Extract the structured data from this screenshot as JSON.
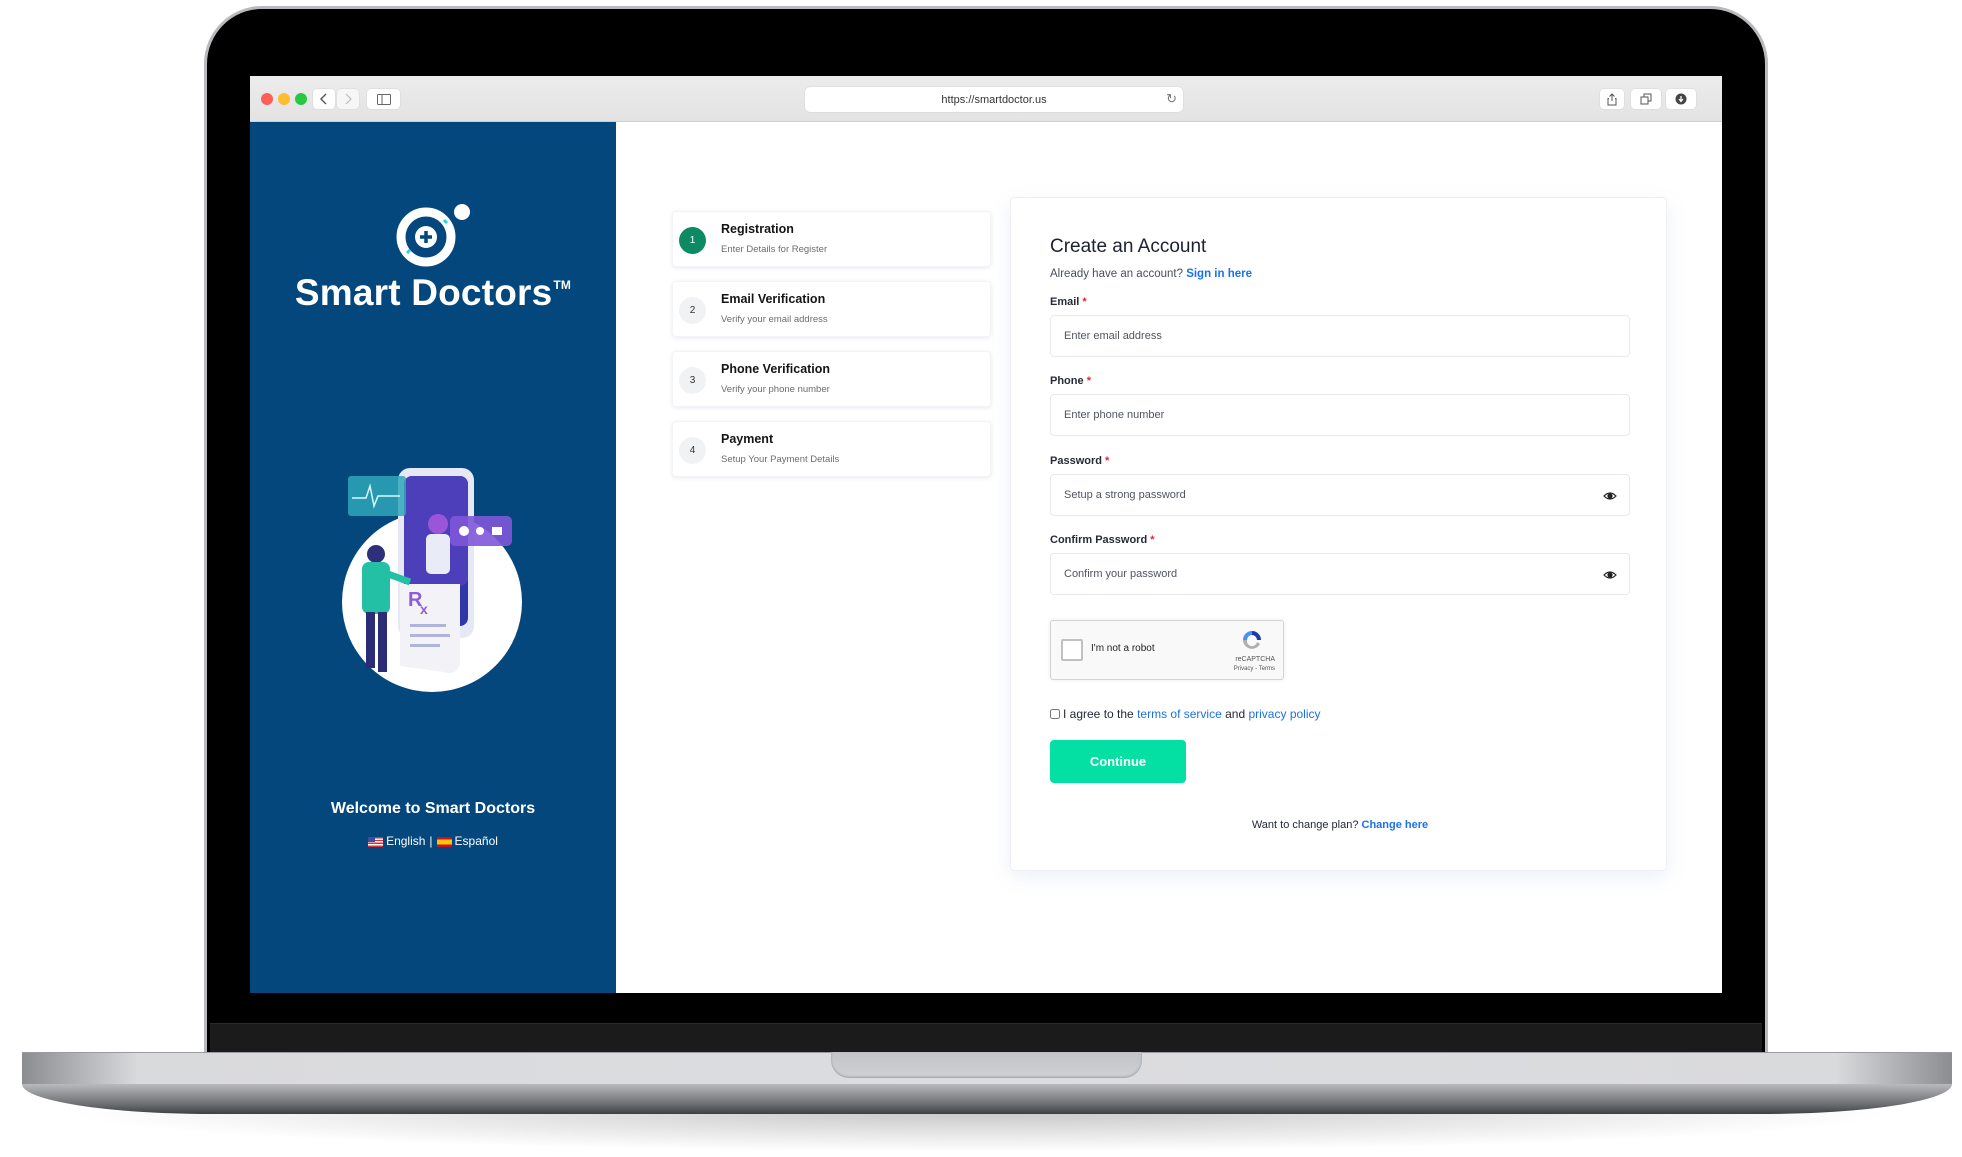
{
  "browser": {
    "url": "https://smartdoctor.us",
    "back_icon": "chevron-left-icon",
    "forward_icon": "chevron-right-icon",
    "sidebar_icon": "sidebar-icon",
    "reload_icon": "reload-icon",
    "share_icon": "share-icon",
    "tabs_icon": "tabs-icon",
    "download_icon": "download-icon"
  },
  "sidebar": {
    "brand": "Smart Doctors",
    "trademark": "TM",
    "welcome": "Welcome to Smart Doctors",
    "languages": [
      {
        "label": "English",
        "flag": "us-flag-icon"
      },
      {
        "label": "Español",
        "flag": "es-flag-icon"
      }
    ],
    "separator": "|",
    "bg_color": "#03477d"
  },
  "steps": [
    {
      "number": "1",
      "title": "Registration",
      "subtitle": "Enter Details for Register",
      "active": true
    },
    {
      "number": "2",
      "title": "Email Verification",
      "subtitle": "Verify your email address",
      "active": false
    },
    {
      "number": "3",
      "title": "Phone Verification",
      "subtitle": "Verify your phone number",
      "active": false
    },
    {
      "number": "4",
      "title": "Payment",
      "subtitle": "Setup Your Payment Details",
      "active": false
    }
  ],
  "form": {
    "title": "Create an Account",
    "signin_prompt": "Already have an account?",
    "signin_link": "Sign in here",
    "required_mark": "*",
    "fields": {
      "email": {
        "label": "Email",
        "placeholder": "Enter email address",
        "value": ""
      },
      "phone": {
        "label": "Phone",
        "placeholder": "Enter phone number",
        "value": ""
      },
      "password": {
        "label": "Password",
        "placeholder": "Setup a strong password",
        "value": ""
      },
      "confirm_password": {
        "label": "Confirm Password",
        "placeholder": "Confirm your password",
        "value": ""
      }
    },
    "captcha": {
      "label": "I'm not a robot",
      "brand": "reCAPTCHA",
      "links": "Privacy - Terms"
    },
    "agree": {
      "prefix": "I agree to the",
      "terms": "terms of service",
      "and": "and",
      "privacy": "privacy policy",
      "checked": false
    },
    "continue_label": "Continue",
    "change_plan_prompt": "Want to change plan?",
    "change_plan_link": "Change here"
  },
  "colors": {
    "accent_button": "#04e0a4",
    "active_step": "#0c8a63",
    "link": "#1b72e8",
    "required": "#e3252c"
  }
}
